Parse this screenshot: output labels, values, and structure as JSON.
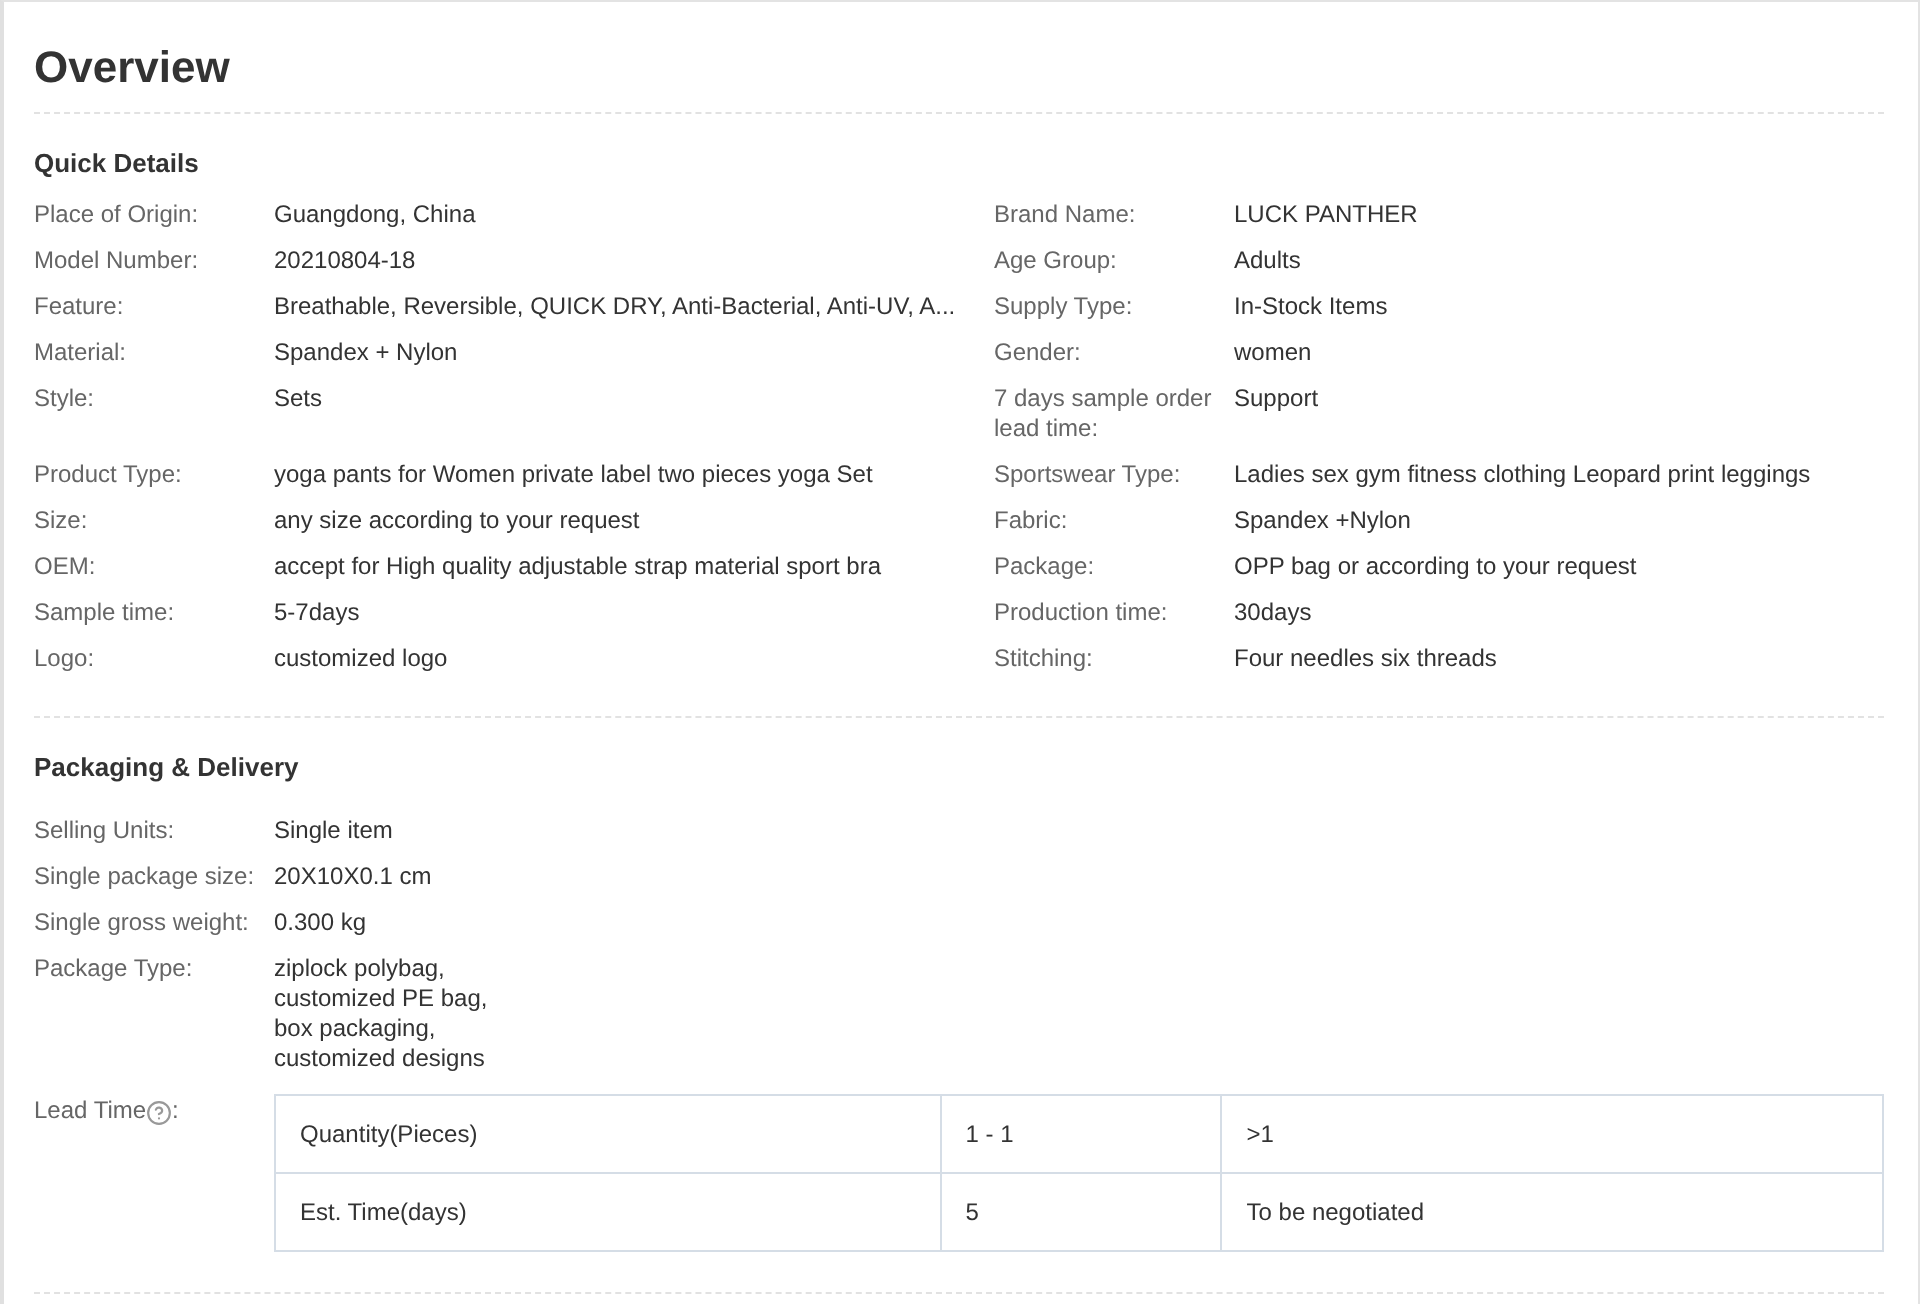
{
  "title": "Overview",
  "quick_details": {
    "heading": "Quick Details",
    "left": [
      {
        "label": "Place of Origin:",
        "value": "Guangdong, China"
      },
      {
        "label": "Model Number:",
        "value": "20210804-18"
      },
      {
        "label": "Feature:",
        "value": "Breathable, Reversible, QUICK DRY, Anti-Bacterial, Anti-UV, A..."
      },
      {
        "label": "Material:",
        "value": "Spandex + Nylon"
      },
      {
        "label": "Style:",
        "value": "Sets"
      },
      {
        "label": "Product Type:",
        "value": "yoga pants for Women private label two pieces yoga Set"
      },
      {
        "label": "Size:",
        "value": "any size according to your request"
      },
      {
        "label": "OEM:",
        "value": "accept for High quality adjustable strap material sport bra"
      },
      {
        "label": "Sample time:",
        "value": "5-7days"
      },
      {
        "label": "Logo:",
        "value": "customized logo"
      }
    ],
    "right": [
      {
        "label": "Brand Name:",
        "value": "LUCK PANTHER"
      },
      {
        "label": "Age Group:",
        "value": "Adults"
      },
      {
        "label": "Supply Type:",
        "value": "In-Stock Items"
      },
      {
        "label": "Gender:",
        "value": "women"
      },
      {
        "label": "7 days sample order lead time:",
        "value": "Support"
      },
      {
        "label": "Sportswear Type:",
        "value": "Ladies sex gym fitness clothing Leopard print leggings"
      },
      {
        "label": "Fabric:",
        "value": "Spandex +Nylon"
      },
      {
        "label": "Package:",
        "value": "OPP bag or according to your request"
      },
      {
        "label": "Production time:",
        "value": "30days"
      },
      {
        "label": "Stitching:",
        "value": "Four needles six threads"
      }
    ]
  },
  "packaging": {
    "heading": "Packaging & Delivery",
    "rows": [
      {
        "label": "Selling Units:",
        "value": "Single item"
      },
      {
        "label": "Single package size:",
        "value": "20X10X0.1 cm"
      },
      {
        "label": "Single gross weight:",
        "value": "0.300 kg"
      },
      {
        "label": "Package Type:",
        "value": "ziplock polybag,\ncustomized PE bag,\nbox packaging,\ncustomized designs"
      }
    ],
    "lead_time": {
      "label": "Lead Time",
      "suffix": ":",
      "table": [
        [
          "Quantity(Pieces)",
          "1 - 1",
          ">1"
        ],
        [
          "Est. Time(days)",
          "5",
          "To be negotiated"
        ]
      ]
    }
  }
}
